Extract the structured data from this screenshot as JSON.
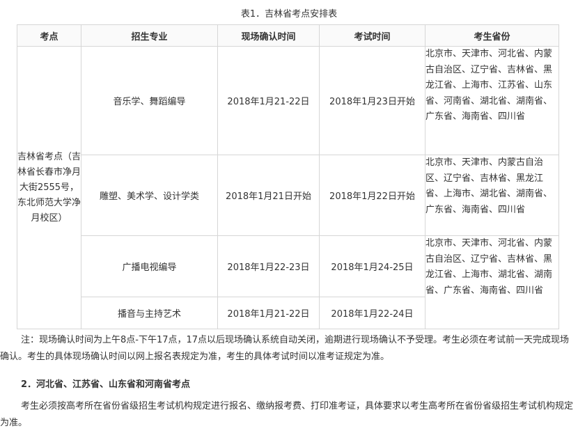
{
  "caption": "表1．吉林省考点安排表",
  "table": {
    "headers": [
      "考点",
      "招生专业",
      "现场确认时间",
      "考试时间",
      "考生省份"
    ],
    "site": "吉林省考点（吉林省长春市净月大街2555号，东北师范大学净月校区）",
    "rows": [
      {
        "major": "音乐学、舞蹈编导",
        "confirm": "2018年1月21-22日",
        "exam": "2018年1月23日开始",
        "provinces": "北京市、天津市、河北省、内蒙古自治区、辽宁省、吉林省、黑龙江省、上海市、江苏省、山东省、河南省、湖北省、湖南省、广东省、海南省、四川省"
      },
      {
        "major": "雕塑、美术学、设计学类",
        "confirm": "2018年1月21日开始",
        "exam": "2018年1月22日开始",
        "provinces": "北京市、天津市、内蒙古自治区、辽宁省、吉林省、黑龙江省、上海市、湖北省、湖南省、广东省、海南省、四川省"
      },
      {
        "major": "广播电视编导",
        "confirm": "2018年1月22-23日",
        "exam": "2018年1月24-25日",
        "provinces": "北京市、天津市、河北省、内蒙古自治区、辽宁省、吉林省、黑龙江省、上海市、湖北省、湖南省、广东省、海南省、四川省"
      },
      {
        "major": "播音与主持艺术",
        "confirm": "2018年1月21-22日",
        "exam": "2018年1月22-24日"
      }
    ]
  },
  "note1": "注：现场确认时间为上午8点-下午17点，17点以后现场确认系统自动关闭，逾期进行现场确认不予受理。考生必须在考试前一天完成现场确认。考生的具体现场确认时间以网上报名表规定为准，考生的具体考试时间以准考证规定为准。",
  "heading2": "2．河北省、江苏省、山东省和河南省考点",
  "note2": "考生必须按高考所在省份省级招生考试机构规定进行报名、缴纳报考费、打印准考证，具体要求以考生高考所在省份省级招生考试机构规定为准。"
}
